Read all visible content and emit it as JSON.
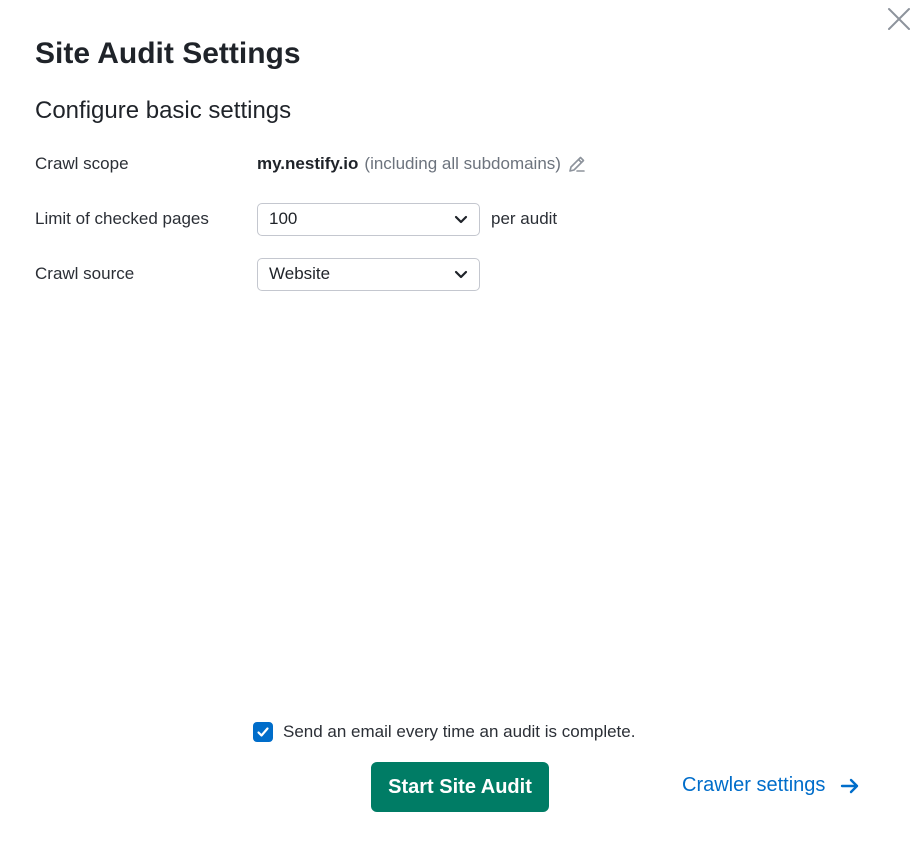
{
  "modal": {
    "title": "Site Audit Settings",
    "subtitle": "Configure basic settings"
  },
  "settings": {
    "crawl_scope": {
      "label": "Crawl scope",
      "domain": "my.nestify.io",
      "note": "(including all subdomains)",
      "edit_icon": "pencil-icon"
    },
    "page_limit": {
      "label": "Limit of checked pages",
      "value": "100",
      "suffix": "per audit"
    },
    "crawl_source": {
      "label": "Crawl source",
      "value": "Website"
    }
  },
  "footer": {
    "email_checkbox_checked": true,
    "email_label": "Send an email every time an audit is complete.",
    "start_button": "Start Site Audit",
    "crawler_link": "Crawler settings"
  },
  "colors": {
    "primary_green": "#007c65",
    "link_blue": "#006dca",
    "checkbox_blue": "#006dca"
  }
}
